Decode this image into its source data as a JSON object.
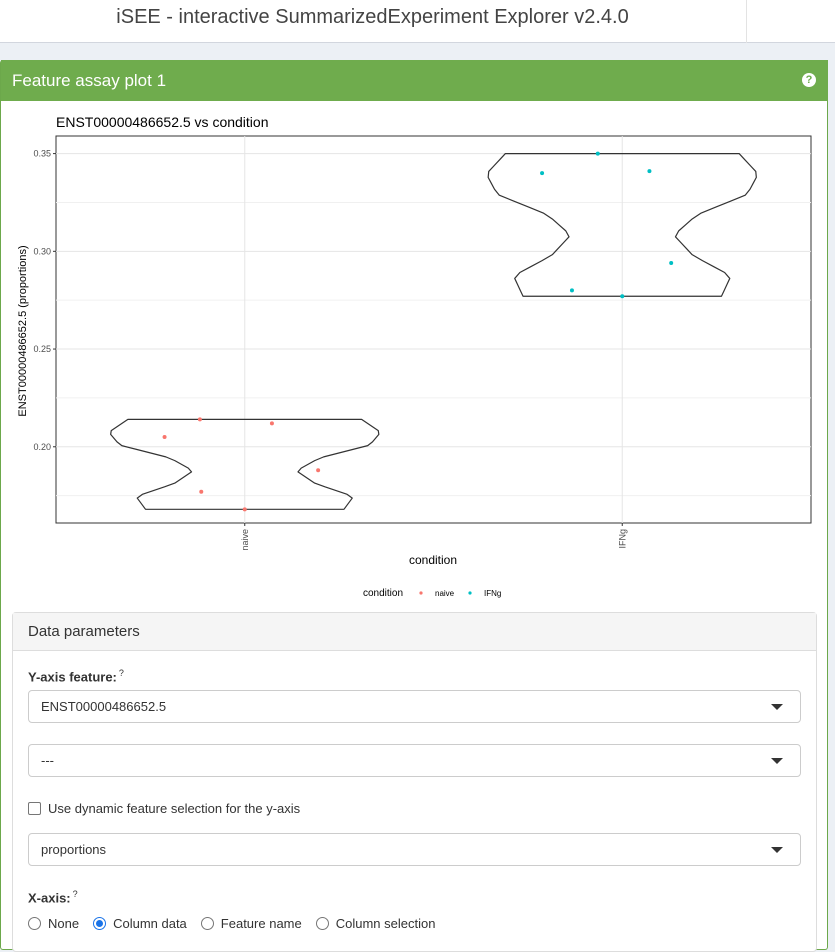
{
  "app": {
    "title": "iSEE - interactive SummarizedExperiment Explorer v2.4.0"
  },
  "panel": {
    "title": "Feature assay plot 1",
    "help_icon": "question-circle-icon"
  },
  "chart_data": {
    "type": "violin",
    "title": "ENST00000486652.5 vs condition",
    "xlabel": "condition",
    "ylabel": "ENST00000486652.5 (proportions)",
    "categories": [
      "naive",
      "IFNg"
    ],
    "ylim": [
      0.161,
      0.359
    ],
    "yticks": [
      0.2,
      0.25,
      0.3,
      0.35
    ],
    "ytick_labels": [
      "0.20",
      "0.25",
      "0.30",
      "0.35"
    ],
    "grid": true,
    "legend": {
      "title": "condition",
      "position": "bottom",
      "entries": [
        {
          "label": "naive",
          "color": "#F8766D"
        },
        {
          "label": "IFNg",
          "color": "#00BFC4"
        }
      ]
    },
    "series": [
      {
        "name": "naive",
        "color": "#F8766D",
        "points": [
          {
            "x": -0.59,
            "y": 0.205
          },
          {
            "x": -0.33,
            "y": 0.214
          },
          {
            "x": 0.2,
            "y": 0.212
          },
          {
            "x": 0.54,
            "y": 0.188
          },
          {
            "x": -0.32,
            "y": 0.177
          },
          {
            "x": 0.0,
            "y": 0.168
          }
        ],
        "violin": {
          "ymin": 0.168,
          "ymax": 0.214
        }
      },
      {
        "name": "IFNg",
        "color": "#00BFC4",
        "points": [
          {
            "x": -0.59,
            "y": 0.34
          },
          {
            "x": -0.18,
            "y": 0.35
          },
          {
            "x": 0.2,
            "y": 0.341
          },
          {
            "x": 0.36,
            "y": 0.294
          },
          {
            "x": -0.37,
            "y": 0.28
          },
          {
            "x": 0.0,
            "y": 0.277
          }
        ],
        "violin": {
          "ymin": 0.277,
          "ymax": 0.35
        }
      }
    ]
  },
  "data_params": {
    "header": "Data parameters",
    "y_feature_label": "Y-axis feature:",
    "help_mark": "?",
    "y_feature_value": "ENST00000486652.5",
    "second_select_value": "---",
    "dynamic_label": "Use dynamic feature selection for the y-axis",
    "assay_value": "proportions",
    "x_axis_label": "X-axis:",
    "x_axis_options": [
      "None",
      "Column data",
      "Feature name",
      "Column selection"
    ],
    "x_axis_selected": "Column data"
  }
}
